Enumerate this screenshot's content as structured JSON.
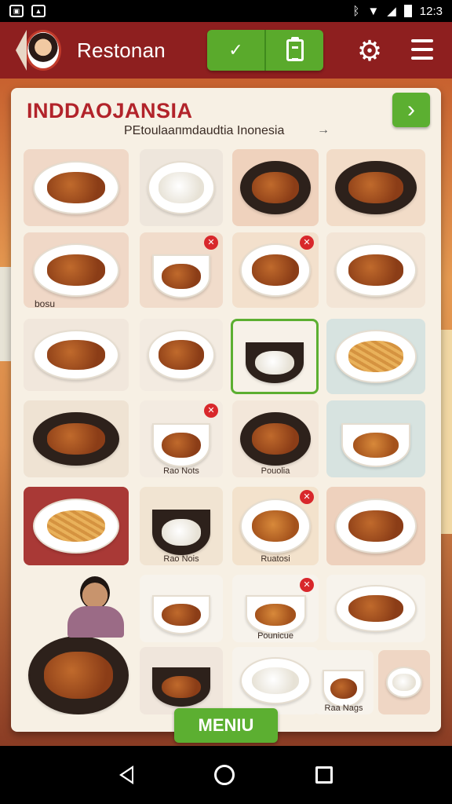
{
  "status_bar": {
    "time": "12:3",
    "left_icons": [
      "image-icon",
      "gallery-icon"
    ],
    "right_icons": [
      "bluetooth-icon",
      "wifi-icon",
      "signal-icon",
      "battery-icon"
    ]
  },
  "app_bar": {
    "title": "Restonan",
    "actions": [
      "check-icon",
      "clipboard-icon",
      "gear-icon",
      "menu-icon"
    ]
  },
  "card": {
    "title": "INDDAOJANSIA",
    "subtitle": "PEtoulaaпmdaudtia Inonesia",
    "subtitle_arrow": "→",
    "next_label": "›"
  },
  "tiles": [
    {
      "label": ""
    },
    {
      "label": ""
    },
    {
      "label": ""
    },
    {
      "label": ""
    },
    {
      "label": "bosu"
    },
    {
      "label": ""
    },
    {
      "label": ""
    },
    {
      "label": ""
    },
    {
      "label": ""
    },
    {
      "label": ""
    },
    {
      "label": ""
    },
    {
      "label": ""
    },
    {
      "label": ""
    },
    {
      "label": "Rao Nots"
    },
    {
      "label": "Pouolia"
    },
    {
      "label": ""
    },
    {
      "label": ""
    },
    {
      "label": "Rao Nois"
    },
    {
      "label": "Ruatosi"
    },
    {
      "label": ""
    },
    {
      "label": ""
    },
    {
      "label": ""
    },
    {
      "label": "Pounicue"
    },
    {
      "label": ""
    },
    {
      "label": ""
    },
    {
      "label": ""
    },
    {
      "label": "Raa Nags"
    },
    {
      "label": ""
    }
  ],
  "menu_button": "MENIU",
  "nav": [
    "back-icon",
    "home-icon",
    "recents-icon"
  ],
  "colors": {
    "app_bar": "#8e1f1f",
    "accent_green": "#5caf31",
    "title_red": "#b2232a",
    "card_bg": "#f7f0e4"
  }
}
